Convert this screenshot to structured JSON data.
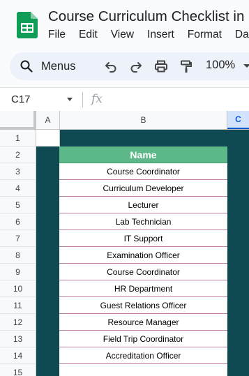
{
  "app": {
    "doc_title": "Course Curriculum Checklist in Google Sheets",
    "menus": [
      "File",
      "Edit",
      "View",
      "Insert",
      "Format",
      "Data"
    ]
  },
  "toolbar": {
    "search_label": "Menus",
    "zoom": "100%",
    "icons": [
      "undo-icon",
      "redo-icon",
      "print-icon",
      "paint-format-icon"
    ]
  },
  "formula_bar": {
    "cell_ref": "C17",
    "fx": "fx"
  },
  "grid": {
    "columns": [
      "A",
      "B",
      "C"
    ],
    "selected_column": "C",
    "rows": [
      "1",
      "2",
      "3",
      "4",
      "5",
      "6",
      "7",
      "8",
      "9",
      "10",
      "11",
      "12",
      "13",
      "14",
      "15"
    ],
    "table_header": "Name",
    "names": [
      "Course Coordinator",
      "Curriculum Developer",
      "Lecturer",
      "Lab Technician",
      "IT Support",
      "Examination Officer",
      "Course Coordinator",
      "HR Department",
      "Guest Relations Officer",
      "Resource Manager",
      "Field Trip Coordinator",
      "Accreditation Officer",
      ""
    ]
  },
  "colors": {
    "canvas_background": "#0f4a52",
    "table_header": "#5cb889",
    "row_divider": "#c27ba0",
    "selection": "#0b57d0"
  }
}
